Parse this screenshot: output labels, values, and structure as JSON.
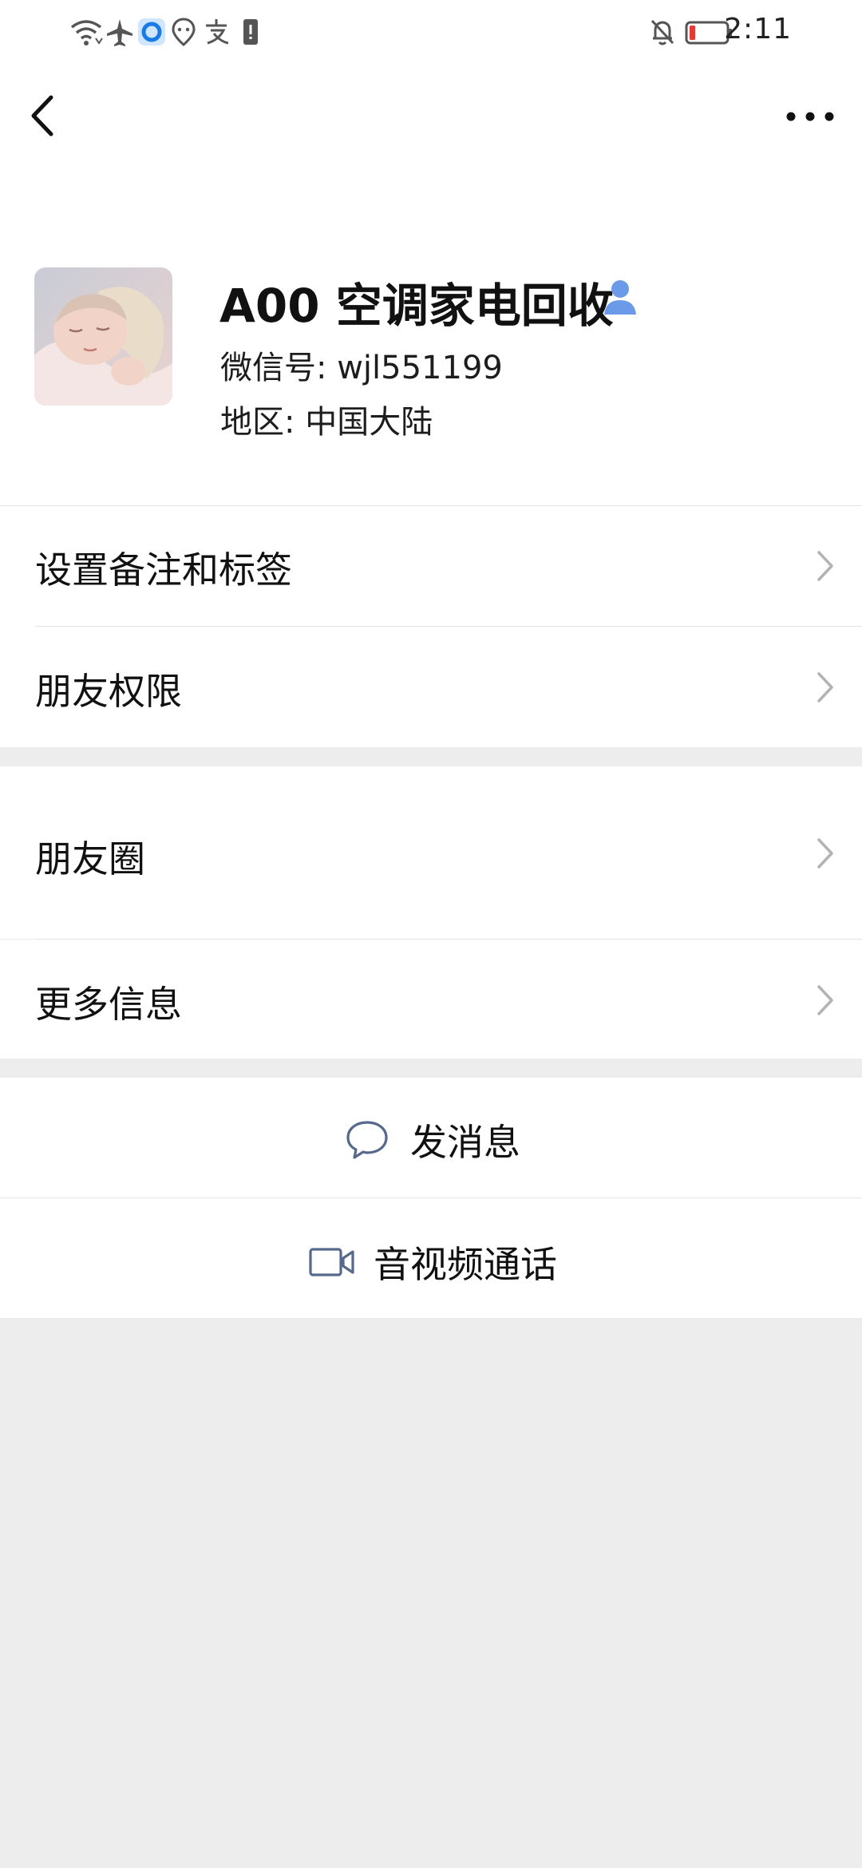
{
  "status_bar": {
    "time": "2:11",
    "icons": [
      "wifi-icon",
      "airplane-mode-icon",
      "browser-app-icon",
      "location-app-icon",
      "alipay-icon",
      "sim-icon",
      "bell-off-icon",
      "battery-low-icon"
    ],
    "battery_color": "#e53935"
  },
  "nav": {
    "back_icon": "back-arrow-icon",
    "more_icon": "more-options-icon"
  },
  "profile": {
    "name": "A00 空调家电回收",
    "wechat_id_label": "微信号: ",
    "wechat_id": "wjl551199",
    "region_label": "地区: ",
    "region": "中国大陆",
    "contact_icon_color": "#6b9be8"
  },
  "menu": {
    "group1": [
      {
        "label": "设置备注和标签"
      },
      {
        "label": "朋友权限"
      }
    ],
    "group2": [
      {
        "label": "朋友圈"
      },
      {
        "label": "更多信息"
      }
    ]
  },
  "actions": {
    "message": "发消息",
    "video_call": "音视频通话",
    "icon_color": "#55698c"
  }
}
